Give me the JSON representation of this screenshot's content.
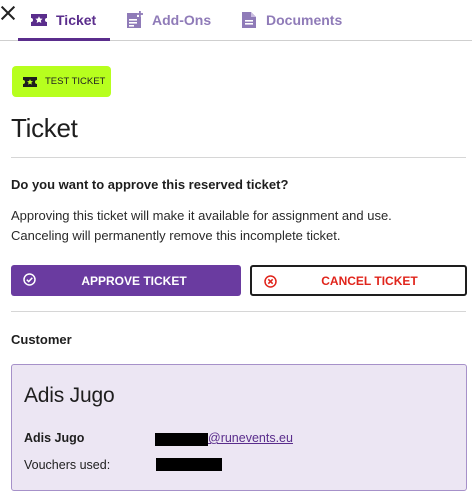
{
  "tabs": [
    {
      "label": "Ticket",
      "icon": "ticket-star-icon",
      "active": true
    },
    {
      "label": "Add-Ons",
      "icon": "document-add-icon",
      "active": false
    },
    {
      "label": "Documents",
      "icon": "document-icon",
      "active": false
    }
  ],
  "badge": {
    "label": "TEST TICKET",
    "icon": "ticket-icon",
    "color": "#b7ff1e"
  },
  "page_title": "Ticket",
  "approval": {
    "question": "Do you want to approve this reserved ticket?",
    "line1": "Approving this ticket will make it available for assignment and use.",
    "line2": "Canceling will permanently remove this incomplete ticket.",
    "approve_label": "APPROVE TICKET",
    "cancel_label": "CANCEL TICKET"
  },
  "customer": {
    "section_title": "Customer",
    "display_name": "Adis Jugo",
    "name_label": "Adis Jugo",
    "email_domain": "@runevents.eu",
    "vouchers_label": "Vouchers used:"
  },
  "colors": {
    "accent": "#5a2d8c",
    "button": "#6a3ba0",
    "danger": "#e0241b",
    "card_bg": "#ece6f3"
  }
}
